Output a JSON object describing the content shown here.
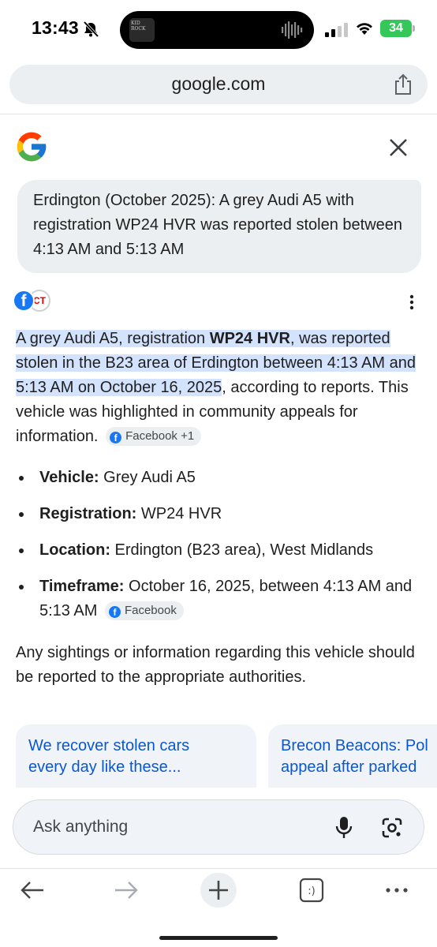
{
  "status_bar": {
    "time": "13:43",
    "battery": "34",
    "island_art_text": "KID ROCK"
  },
  "browser": {
    "url": "google.com"
  },
  "query": {
    "text": "Erdington (October 2025): A grey Audi A5 with registration WP24 HVR was reported stolen between 4:13 AM and 5:13 AM"
  },
  "answer": {
    "hl1": "A grey Audi A5, registration ",
    "hl2": "WP24 HVR",
    "hl3": ", was reported stolen in the B23 area of Erdington between 4:13 AM and 5:13 AM on October 16, 2025",
    "rest": ", according to reports. This vehicle was highlighted in community appeals for information.",
    "source_chip": "Facebook +1",
    "source_chip_icon": "facebook-icon"
  },
  "bullets": [
    {
      "label": "Vehicle:",
      "value": " Grey Audi A5"
    },
    {
      "label": "Registration:",
      "value": " WP24 HVR"
    },
    {
      "label": "Location:",
      "value": " Erdington (B23 area), West Midlands"
    },
    {
      "label": "Timeframe:",
      "value": " October 16, 2025, between 4:13 AM and 5:13 AM",
      "chip": "Facebook"
    }
  ],
  "closing": "Any sightings or information regarding this vehicle should be reported to the appropriate authorities.",
  "cards": [
    {
      "line1": "We recover stolen cars",
      "line2": "every day like these..."
    },
    {
      "line1": "Brecon Beacons: Pol",
      "line2": "appeal after parked"
    }
  ],
  "ask_bar": {
    "placeholder": "Ask anything"
  },
  "toolbar": {
    "tabs_label": ":)"
  },
  "colors": {
    "highlight": "#d3e3fd",
    "link": "#0b57d0",
    "battery": "#34c759",
    "facebook": "#1877f2"
  }
}
